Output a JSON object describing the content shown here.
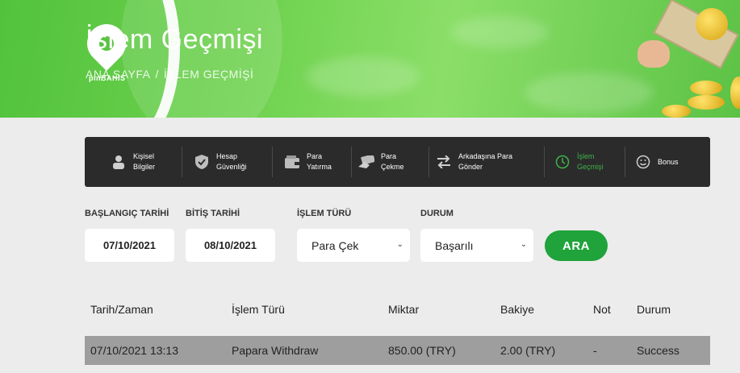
{
  "header": {
    "title": "İşlem Geçmişi",
    "breadcrumb": {
      "home": "ANA SAYFA",
      "separator": "/",
      "current": "İŞLEM GEÇMİŞİ"
    },
    "brand": "pinBAHIS"
  },
  "nav": {
    "items": [
      {
        "label_line1": "Kişisel",
        "label_line2": "Bilgiler",
        "icon": "person-icon",
        "active": false
      },
      {
        "label_line1": "Hesap",
        "label_line2": "Güvenliği",
        "icon": "shield-icon",
        "active": false
      },
      {
        "label_line1": "Para",
        "label_line2": "Yatırma",
        "icon": "wallet-icon",
        "active": false
      },
      {
        "label_line1": "Para",
        "label_line2": "Çekme",
        "icon": "money-out-icon",
        "active": false
      },
      {
        "label_line1": "Arkadaşına Para",
        "label_line2": "Gönder",
        "icon": "transfer-icon",
        "active": false
      },
      {
        "label_line1": "İşlem",
        "label_line2": "Geçmişi",
        "icon": "history-icon",
        "active": true
      },
      {
        "label_line1": "Bonus",
        "label_line2": "",
        "icon": "smile-icon",
        "active": false
      }
    ]
  },
  "filters": {
    "start_date_label": "BAŞLANGIÇ TARİHİ",
    "start_date_value": "07/10/2021",
    "end_date_label": "BİTİŞ TARİHİ",
    "end_date_value": "08/10/2021",
    "type_label": "İŞLEM TÜRÜ",
    "type_value": "Para Çek",
    "status_label": "DURUM",
    "status_value": "Başarılı",
    "search_label": "ARA"
  },
  "table": {
    "columns": [
      "Tarih/Zaman",
      "İşlem Türü",
      "Miktar",
      "Bakiye",
      "Not",
      "Durum"
    ],
    "rows": [
      [
        "07/10/2021 13:13",
        "Papara Withdraw",
        "850.00 (TRY)",
        "2.00 (TRY)",
        "-",
        "Success"
      ]
    ]
  },
  "colors": {
    "accent": "#1fa33a",
    "active_nav": "#3fb34a",
    "nav_bg": "#2b2b2b",
    "row_bg": "#9e9e9e"
  }
}
